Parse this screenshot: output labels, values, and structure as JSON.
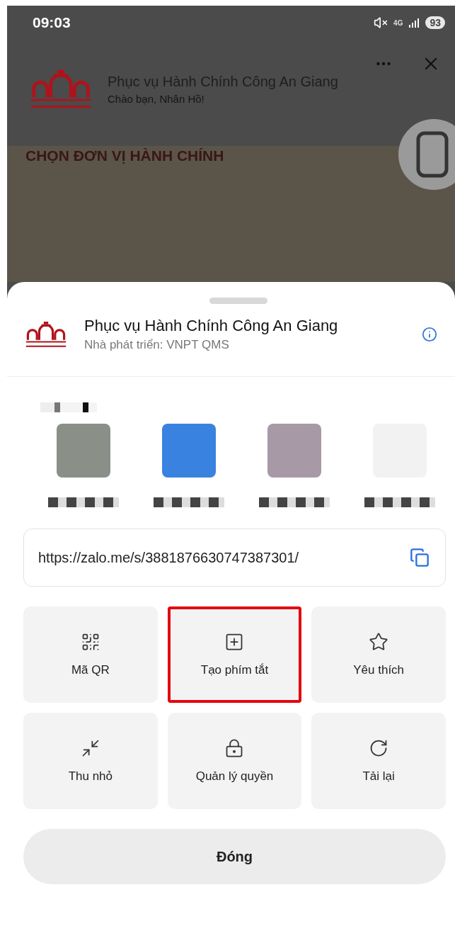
{
  "status_bar": {
    "time": "09:03",
    "network": "4G",
    "battery": "93"
  },
  "app": {
    "title": "Phục vụ Hành Chính Công An Giang",
    "greeting": "Chào bạn, Nhân Hồ!",
    "section_title": "CHỌN ĐƠN VỊ HÀNH CHÍNH"
  },
  "sheet": {
    "app_name": "Phục vụ Hành Chính Công An Giang",
    "developer": "Nhà phát triển: VNPT QMS",
    "share_targets": [
      {
        "color": "#8a8f88"
      },
      {
        "color": "#3a82e0"
      },
      {
        "color": "#a79aa6"
      },
      {
        "color": "#f2f2f2"
      }
    ],
    "link": "https://zalo.me/s/3881876630747387301/",
    "actions": [
      {
        "kind": "qr",
        "label": "Mã QR",
        "highlighted": false
      },
      {
        "kind": "shortcut",
        "label": "Tạo phím tắt",
        "highlighted": true
      },
      {
        "kind": "favorite",
        "label": "Yêu thích",
        "highlighted": false
      },
      {
        "kind": "minimize",
        "label": "Thu nhỏ",
        "highlighted": false
      },
      {
        "kind": "permissions",
        "label": "Quản lý quyền",
        "highlighted": false
      },
      {
        "kind": "reload",
        "label": "Tải lại",
        "highlighted": false
      }
    ],
    "close_button": "Đóng"
  }
}
